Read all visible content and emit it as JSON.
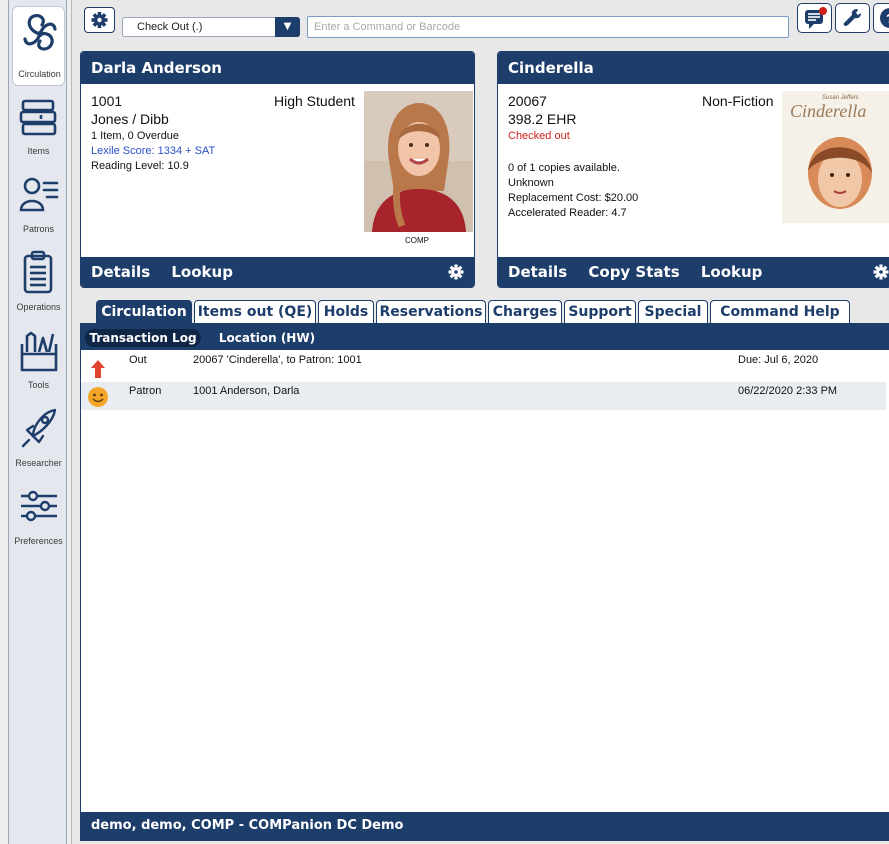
{
  "sidebar": {
    "items": [
      {
        "label": "Circulation",
        "icon": "circulation-icon"
      },
      {
        "label": "Items",
        "icon": "books-icon"
      },
      {
        "label": "Patrons",
        "icon": "patrons-icon"
      },
      {
        "label": "Operations",
        "icon": "clipboard-icon"
      },
      {
        "label": "Tools",
        "icon": "tools-icon"
      },
      {
        "label": "Researcher",
        "icon": "rocket-icon"
      },
      {
        "label": "Preferences",
        "icon": "sliders-icon"
      }
    ]
  },
  "toolbar": {
    "mode": "Check Out (.)",
    "command_placeholder": "Enter a Command or Barcode"
  },
  "patron": {
    "name": "Darla Anderson",
    "barcode": "1001",
    "type": "High Student",
    "homeroom": "Jones / Dibb",
    "items_summary": "1 Item, 0 Overdue",
    "lexile": "Lexile Score: 1334 + SAT",
    "reading_level": "Reading Level: 10.9",
    "photo_caption": "COMP",
    "footer": {
      "details": "Details",
      "lookup": "Lookup"
    }
  },
  "item": {
    "title": "Cinderella",
    "barcode": "20067",
    "call_number": "398.2 EHR",
    "status": "Checked out",
    "category": "Non-Fiction",
    "copies": "0 of 1 copies available.",
    "unknown": "Unknown",
    "replacement": "Replacement Cost: $20.00",
    "ar": "Accelerated Reader: 4.7",
    "cover_author": "Susan Jeffers",
    "cover_title": "Cinderella",
    "footer": {
      "details": "Details",
      "copy_stats": "Copy Stats",
      "lookup": "Lookup"
    }
  },
  "tabs": [
    "Circulation",
    "Items out (QE)",
    "Holds",
    "Reservations",
    "Charges",
    "Support",
    "Special",
    "Command Help (?)"
  ],
  "subtabs": [
    "Transaction Log",
    "Location (HW)"
  ],
  "log": [
    {
      "action": "Out",
      "detail": "20067 'Cinderella', to Patron: 1001",
      "right": "Due: Jul 6, 2020",
      "icon": "checkout-arrow-icon"
    },
    {
      "action": "Patron",
      "detail": "1001 Anderson, Darla",
      "right": "06/22/2020 2:33 PM",
      "icon": "smiley-icon"
    }
  ],
  "status_bar": "demo, demo, COMP - COMPanion DC Demo",
  "colors": {
    "navy": "#1d3d6b",
    "status_red": "#d0201a",
    "link_blue": "#2b50c8"
  }
}
